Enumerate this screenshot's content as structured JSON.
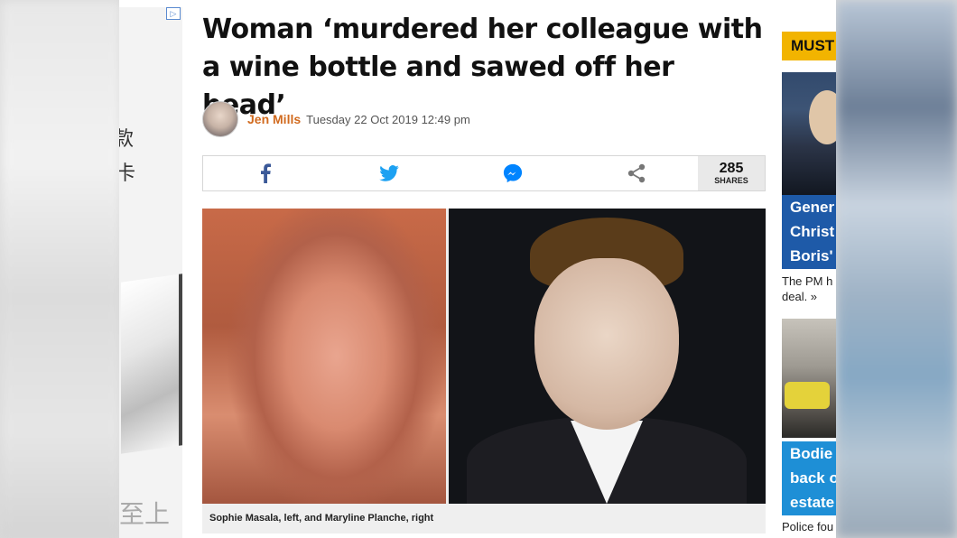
{
  "ad": {
    "adchoices_label": "▷",
    "chinese_text_1": "款",
    "chinese_text_2": "卡",
    "chinese_text_3": "至上"
  },
  "article": {
    "headline": "Woman ‘murdered her colleague with a wine bottle and sawed off her head’",
    "author": "Jen Mills",
    "date": "Tuesday 22 Oct 2019 12:49 pm",
    "share": {
      "count": "285",
      "count_label": "SHARES",
      "icons": [
        "facebook-icon",
        "twitter-icon",
        "messenger-icon",
        "share-icon"
      ]
    },
    "photo_caption": "Sophie Masala, left, and Maryline Planche, right"
  },
  "rail": {
    "header": "MUST",
    "card1": {
      "title_lines": [
        "Gener",
        "Christ",
        "Boris'"
      ],
      "text_lines": [
        "The PM h",
        "deal. »"
      ]
    },
    "card2": {
      "title_lines": [
        "Bodie",
        "back o",
        "estate"
      ],
      "text": "Police fou"
    }
  },
  "colors": {
    "author": "#d16a1e",
    "facebook": "#3b5998",
    "twitter": "#1da1f2",
    "messenger": "#0084ff",
    "must_read": "#f2b400",
    "card1_title_bg": "#1e5aa8",
    "card2_title_bg": "#1e8fd6"
  }
}
